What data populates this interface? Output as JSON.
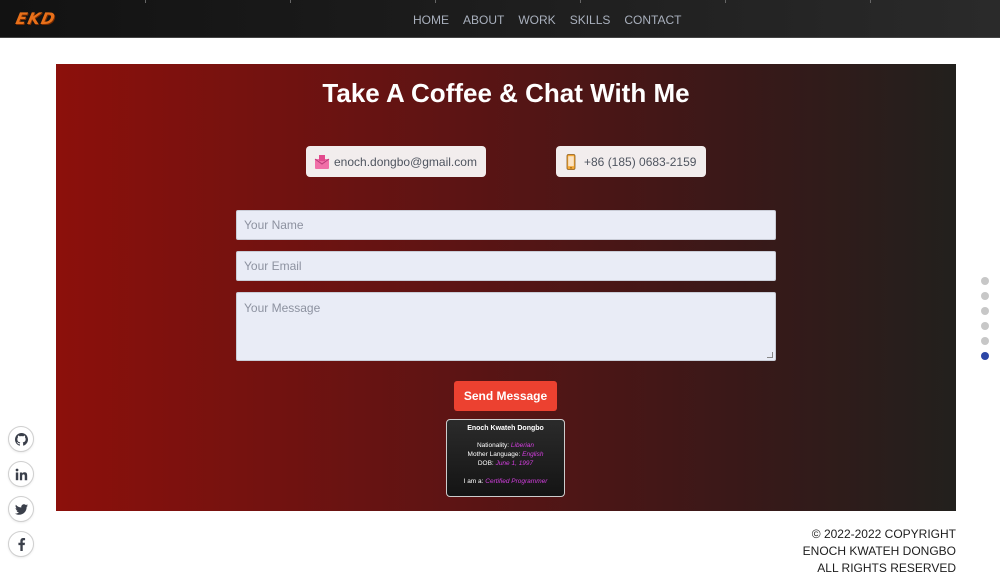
{
  "brand": {
    "logo_text": "EKD",
    "accent": "#e8701a"
  },
  "nav": {
    "items": [
      "HOME",
      "ABOUT",
      "WORK",
      "SKILLS",
      "CONTACT"
    ]
  },
  "contact": {
    "title": "Take A Coffee & Chat With Me",
    "email": "enoch.dongbo@gmail.com",
    "email_icon": "mail-icon",
    "phone": "+86 (185) 0683-2159",
    "phone_icon": "phone-icon",
    "form": {
      "name_placeholder": "Your Name",
      "email_placeholder": "Your Email",
      "message_placeholder": "Your Message",
      "send_label": "Send Message",
      "send_color": "#ec4130"
    },
    "card": {
      "name": "Enoch Kwateh Dongbo",
      "nationality_label": "Nationality:",
      "nationality_value": "Liberian",
      "language_label": "Mother Language:",
      "language_value": "English",
      "dob_label": "DOB:",
      "dob_value": "June 1, 1997",
      "role_label": "I am a:",
      "role_value": "Certified Programmer",
      "accent": "#d43ee0"
    }
  },
  "section_dots": {
    "count": 6,
    "active_index": 5,
    "active_color": "#2c46a6"
  },
  "social": [
    {
      "icon": "github-icon"
    },
    {
      "icon": "linkedin-icon"
    },
    {
      "icon": "twitter-icon"
    },
    {
      "icon": "facebook-icon"
    }
  ],
  "footer": {
    "line1": "© 2022-2022 COPYRIGHT",
    "line2": "ENOCH KWATEH DONGBO",
    "line3": "ALL RIGHTS RESERVED"
  }
}
